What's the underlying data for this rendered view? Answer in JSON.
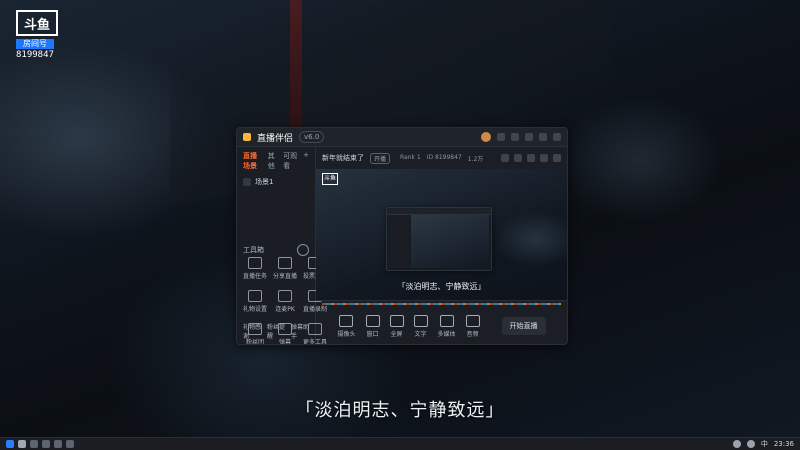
{
  "watermark": {
    "logo": "斗鱼",
    "badge": "房间号",
    "room_number": "8199847"
  },
  "subtitle": "「淡泊明志、宁静致远」",
  "app": {
    "title": "直播伴侣",
    "version": "v6.0",
    "tabs": [
      {
        "label": "直播场景",
        "active": true
      },
      {
        "label": "其他",
        "active": false
      },
      {
        "label": "可观看",
        "active": false
      }
    ],
    "sidebar": {
      "scene_label": "场景1",
      "section_title": "工具箱",
      "tools": [
        {
          "icon": "task-icon",
          "label": "直播任务"
        },
        {
          "icon": "share-icon",
          "label": "分享直播"
        },
        {
          "icon": "poll-icon",
          "label": "投票互动"
        },
        {
          "icon": "gift-icon",
          "label": "礼物设置"
        },
        {
          "icon": "mic-icon",
          "label": "连麦PK"
        },
        {
          "icon": "record-icon",
          "label": "直播录制"
        },
        {
          "icon": "fans-icon",
          "label": "粉丝团"
        },
        {
          "icon": "bullet-icon",
          "label": "弹幕"
        },
        {
          "icon": "settings-icon",
          "label": "更多工具"
        }
      ],
      "footer": [
        "礼物感谢",
        "粉丝提醒",
        "弹幕助手"
      ]
    },
    "room": {
      "title": "新年就结束了",
      "tag": "开播",
      "stats": [
        "Rank 1",
        "ID 8199847",
        "1.2万"
      ]
    },
    "preview": {
      "watermark": "斗鱼",
      "subtitle": "「淡泊明志、宁静致远」"
    },
    "controls": [
      {
        "icon": "screen-icon",
        "label": "摄像头"
      },
      {
        "icon": "location-icon",
        "label": "窗口"
      },
      {
        "icon": "image-icon",
        "label": "全屏"
      },
      {
        "icon": "text-icon",
        "label": "文字"
      },
      {
        "icon": "media-icon",
        "label": "多媒体"
      },
      {
        "icon": "audio-icon",
        "label": "音频"
      }
    ],
    "start_live_label": "开始直播"
  },
  "taskbar": {
    "ime": "中",
    "time": "23:36",
    "icons": [
      "start-icon",
      "search-icon",
      "explorer-icon",
      "edge-icon",
      "chat-icon",
      "app-icon"
    ]
  }
}
